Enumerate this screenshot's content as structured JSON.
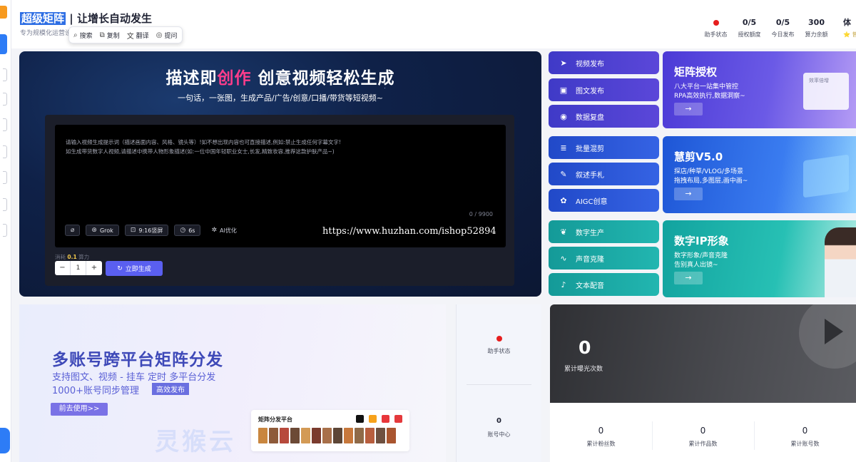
{
  "header": {
    "brand_highlight": "超级矩阵",
    "brand_rest": " | 让增长自动发生",
    "subtitle": "专为规模化运营设",
    "toolbar": {
      "search": "搜索",
      "copy": "复制",
      "translate": "翻译",
      "ask": "提问"
    },
    "stats": [
      {
        "value": "",
        "label": "助手状态",
        "status_color": "#e61e1e"
      },
      {
        "value": "0/5",
        "label": "授权额度"
      },
      {
        "value": "0/5",
        "label": "今日发布"
      },
      {
        "value": "300",
        "label": "算力余额"
      },
      {
        "value": "体",
        "label": "⭐ 普"
      }
    ]
  },
  "hero": {
    "title_a": "描述即",
    "title_b": "创作",
    "title_c": " 创意视频轻松生成",
    "subtitle": "一句话，一张图，生成产品/广告/创意/口播/带货等短视频~",
    "prompt_line1": "请输入视频生成提示词（描述画面内容、风格、镜头等）!如不想出现内容也可直接描述,例如:禁止生成任何字幕文字!",
    "prompt_line2": "如生成带货数字人视频,请描述中携带人物形象描述(如:一位中国年轻职业女士,长发,精致妆容,推荐这款护肤产品~)",
    "counter": "0 / 9900",
    "options": {
      "model": "Grok",
      "ratio": "9:16竖屏",
      "duration": "6s",
      "optimize": "AI优化"
    },
    "cost_label": "消耗",
    "cost_value": "0.1",
    "cost_unit": "算力",
    "quantity": "1",
    "minus": "−",
    "plus": "+",
    "generate": "立即生成"
  },
  "watermark": "https://www.huzhan.com/ishop52894",
  "features": [
    {
      "label": "视频发布",
      "icon": "send-icon"
    },
    {
      "label": "图文发布",
      "icon": "image-icon"
    },
    {
      "label": "数据复盘",
      "icon": "data-icon"
    },
    {
      "label": "批量混剪",
      "icon": "layers-icon"
    },
    {
      "label": "叙述手札",
      "icon": "note-icon"
    },
    {
      "label": "AIGC创意",
      "icon": "aigc-icon"
    },
    {
      "label": "数字生产",
      "icon": "leaf-icon"
    },
    {
      "label": "声音克隆",
      "icon": "wave-icon"
    },
    {
      "label": "文本配音",
      "icon": "mic-icon"
    }
  ],
  "promos": [
    {
      "title": "矩阵授权",
      "desc1": "八大平台一站集中管控",
      "desc2": "RPA高效执行,数据洞察~",
      "arrow": "→",
      "deco_text": "效率倍增"
    },
    {
      "title": "慧剪V5.0",
      "desc1": "探店/种草/VLOG/多场景",
      "desc2": "拖拽布局,多图层,画中画~",
      "arrow": "→"
    },
    {
      "title": "数字IP形象",
      "desc1": "数字形象/声音克隆",
      "desc2": "告别真人出镜~",
      "arrow": "→"
    }
  ],
  "banner": {
    "title": "多账号跨平台矩阵分发",
    "line1": "支持图文、视频 - 挂车 定时 多平台分发",
    "line2": "1000+账号同步管理",
    "tag": "高效发布",
    "cta": "前去使用>>",
    "platform_title": "矩阵分发平台",
    "watermark_text": "灵猴云"
  },
  "helper": {
    "status_label": "助手状态",
    "account_value": "0",
    "account_label": "账号中心"
  },
  "exposure": {
    "value": "0",
    "label": "累计曝光次数"
  },
  "totals": [
    {
      "value": "0",
      "label": "累计粉丝数"
    },
    {
      "value": "0",
      "label": "累计作品数"
    },
    {
      "value": "0",
      "label": "累计账号数"
    }
  ],
  "colors": {
    "accent": "#5a5ff0",
    "status_red": "#e61e1e",
    "brand_blue": "#2f6fe4"
  }
}
